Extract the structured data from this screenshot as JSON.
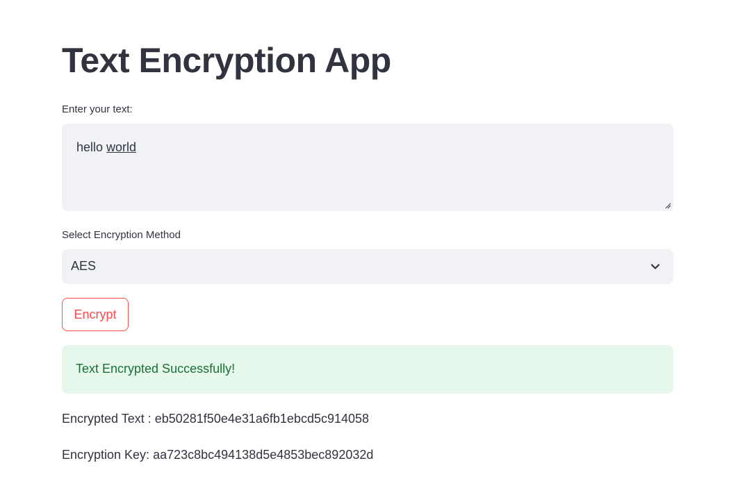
{
  "app": {
    "title": "Text Encryption App"
  },
  "text_input": {
    "label": "Enter your text:",
    "value_plain": "hello ",
    "value_underlined": "world"
  },
  "method_select": {
    "label": "Select Encryption Method",
    "selected": "AES",
    "icon": "chevron-down-icon"
  },
  "encrypt_button": {
    "label": "Encrypt"
  },
  "alert": {
    "message": "Text Encrypted Successfully!"
  },
  "results": {
    "encrypted_text_line": "Encrypted Text : eb50281f50e4e31a6fb1ebcd5c914058",
    "encryption_key_line": "Encryption Key: aa723c8bc494138d5e4853bec892032d"
  },
  "colors": {
    "text": "#31333f",
    "input_background": "#f0f2f6",
    "accent": "#ff4b4b",
    "success_background": "#e6f7eb",
    "success_text": "#177233"
  }
}
